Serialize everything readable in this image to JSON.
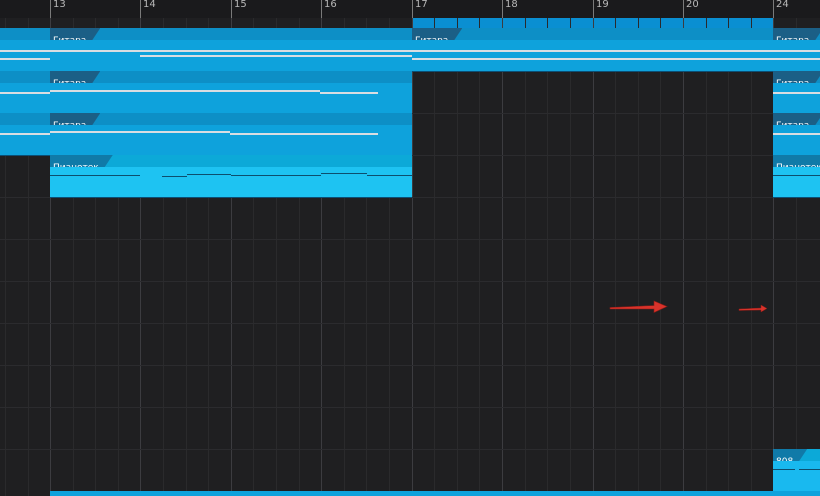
{
  "ruler": {
    "bars": [
      "13",
      "14",
      "15",
      "16",
      "17",
      "18",
      "19",
      "20",
      "24"
    ]
  },
  "tracks": {
    "guitar_1": {
      "clips": [
        "Гитара",
        "Гитара",
        "Гитара"
      ]
    },
    "guitar_2": {
      "clips": [
        "Гитара",
        "Гитара"
      ]
    },
    "guitar_3": {
      "clips": [
        "Гитара",
        "Гитара"
      ]
    },
    "piano": {
      "clips": [
        "Пианотек",
        "Пианотек"
      ]
    },
    "drums": {
      "clips": [
        "808"
      ]
    }
  },
  "colors": {
    "background": "#1f1f21",
    "clip_blue": "#0ea2dc",
    "clip_cyan": "#1ec3f2",
    "arrow_red": "#d9332b"
  },
  "icons": [
    "arrow-right-icon",
    "arrow-right-icon"
  ]
}
